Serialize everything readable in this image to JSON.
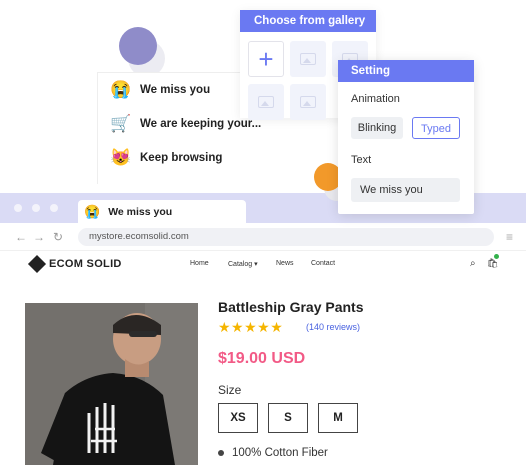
{
  "tab_titles": [
    {
      "emoji": "😭",
      "label": "We miss you"
    },
    {
      "emoji": "🛒",
      "label": "We are keeping your..."
    },
    {
      "emoji": "😻",
      "label": "Keep browsing"
    }
  ],
  "gallery": {
    "title": "Choose from gallery",
    "add_icon": "+"
  },
  "setting": {
    "title": "Setting",
    "animation_label": "Animation",
    "blinking_label": "Blinking",
    "typed_label": "Typed",
    "text_label": "Text",
    "text_value": "We miss you"
  },
  "browser": {
    "tab_emoji": "😭",
    "tab_title": "We miss you",
    "url": "mystore.ecomsolid.com",
    "back_icon": "←",
    "forward_icon": "→",
    "reload_icon": "↻",
    "menu_icon": "≡"
  },
  "store": {
    "logo": "ECOM SOLID",
    "nav": [
      "Home",
      "Catalog ▾",
      "News",
      "Contact"
    ],
    "search_icon": "⌕",
    "cart_icon": "🛍"
  },
  "product": {
    "title": "Battleship Gray Pants",
    "stars": "★★★★★",
    "rating": 5,
    "reviews": "(140 reviews)",
    "price": "$19.00 USD",
    "size_label": "Size",
    "sizes": [
      "XS",
      "S",
      "M"
    ],
    "feature": "100% Cotton Fiber"
  },
  "colors": {
    "accent": "#6a79f2",
    "price": "#f25a86",
    "star": "#f5b500"
  }
}
